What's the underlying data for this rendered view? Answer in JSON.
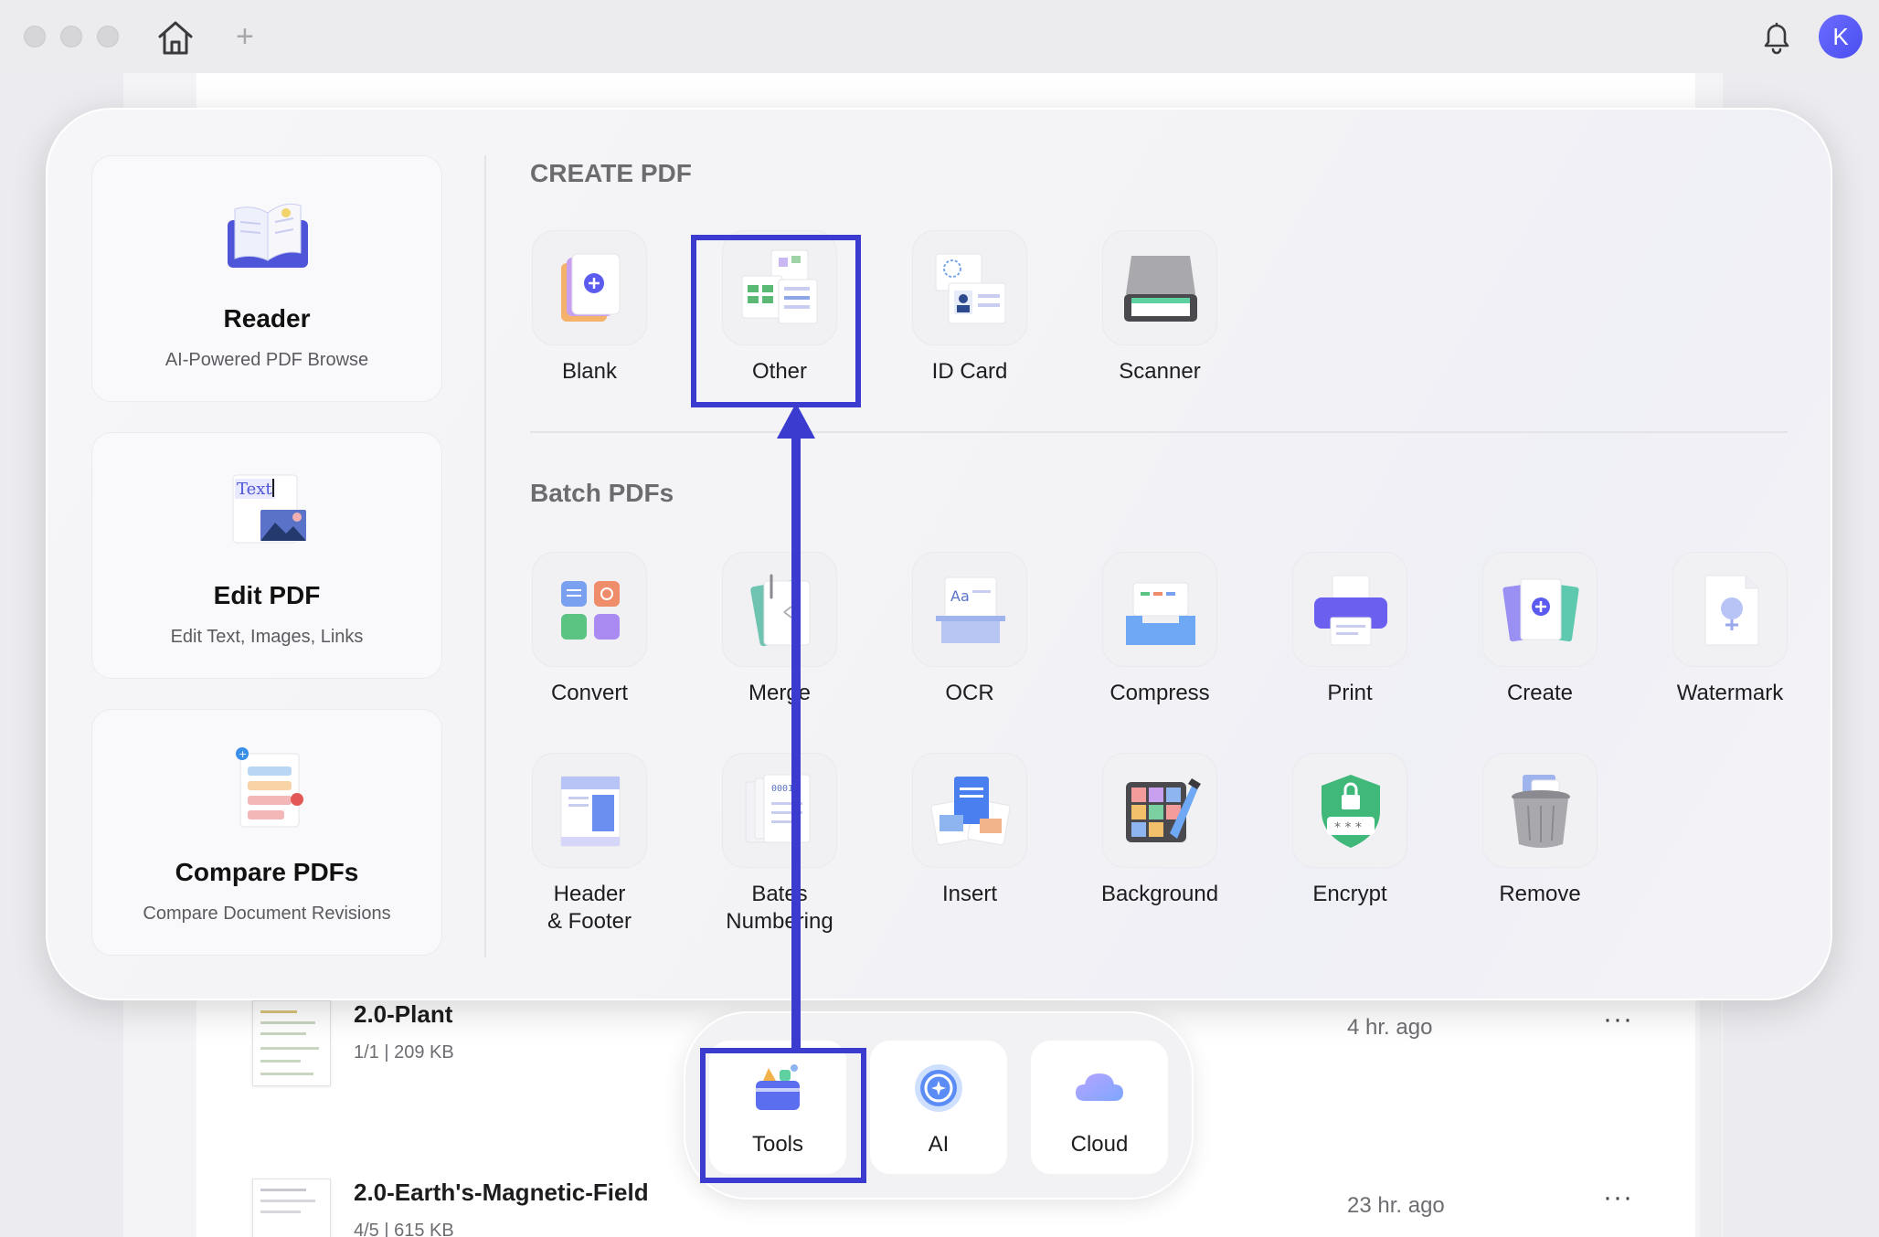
{
  "titlebar": {
    "avatar_initial": "K",
    "icons": [
      "close-icon",
      "minimize-icon",
      "zoom-icon",
      "home-icon",
      "plus-icon",
      "bell-icon"
    ]
  },
  "left_cards": [
    {
      "title": "Reader",
      "subtitle": "AI-Powered PDF Browse",
      "icon": "book-icon"
    },
    {
      "title": "Edit PDF",
      "subtitle": "Edit Text, Images, Links",
      "icon": "edit-text-image-icon"
    },
    {
      "title": "Compare PDFs",
      "subtitle": "Compare Document Revisions",
      "icon": "compare-icon"
    }
  ],
  "create_pdf": {
    "title": "CREATE PDF",
    "tools": [
      {
        "label": "Blank",
        "icon": "blank-page-icon"
      },
      {
        "label": "Other",
        "icon": "other-files-icon"
      },
      {
        "label": "ID Card",
        "icon": "id-card-icon"
      },
      {
        "label": "Scanner",
        "icon": "scanner-icon"
      }
    ]
  },
  "batch_pdfs": {
    "title": "Batch PDFs",
    "row1": [
      {
        "label": "Convert",
        "icon": "convert-icon"
      },
      {
        "label": "Merge",
        "icon": "merge-icon"
      },
      {
        "label": "OCR",
        "icon": "ocr-icon"
      },
      {
        "label": "Compress",
        "icon": "compress-icon"
      },
      {
        "label": "Print",
        "icon": "print-icon"
      },
      {
        "label": "Create",
        "icon": "create-icon"
      },
      {
        "label": "Watermark",
        "icon": "watermark-icon"
      }
    ],
    "row2": [
      {
        "label_line1": "Header",
        "label_line2": "& Footer",
        "icon": "header-footer-icon"
      },
      {
        "label_line1": "Bates",
        "label_line2": "Numbering",
        "icon": "bates-numbering-icon"
      },
      {
        "label_line1": "Insert",
        "label_line2": "",
        "icon": "insert-icon"
      },
      {
        "label_line1": "Background",
        "label_line2": "",
        "icon": "background-icon"
      },
      {
        "label_line1": "Encrypt",
        "label_line2": "",
        "icon": "encrypt-icon"
      },
      {
        "label_line1": "Remove",
        "label_line2": "",
        "icon": "remove-icon"
      }
    ]
  },
  "files": [
    {
      "name": "2.0-Plant",
      "meta": "1/1 | 209 KB",
      "time": "4 hr. ago",
      "more": "···"
    },
    {
      "name": "2.0-Earth's-Magnetic-Field",
      "meta": "4/5 | 615 KB",
      "time": "23 hr. ago",
      "more": "···"
    }
  ],
  "dock": [
    {
      "label": "Tools",
      "icon": "toolbox-icon"
    },
    {
      "label": "AI",
      "icon": "ai-icon"
    },
    {
      "label": "Cloud",
      "icon": "cloud-icon"
    }
  ],
  "colors": {
    "annotation": "#3b3bcf",
    "accent": "#5b5bf0"
  }
}
